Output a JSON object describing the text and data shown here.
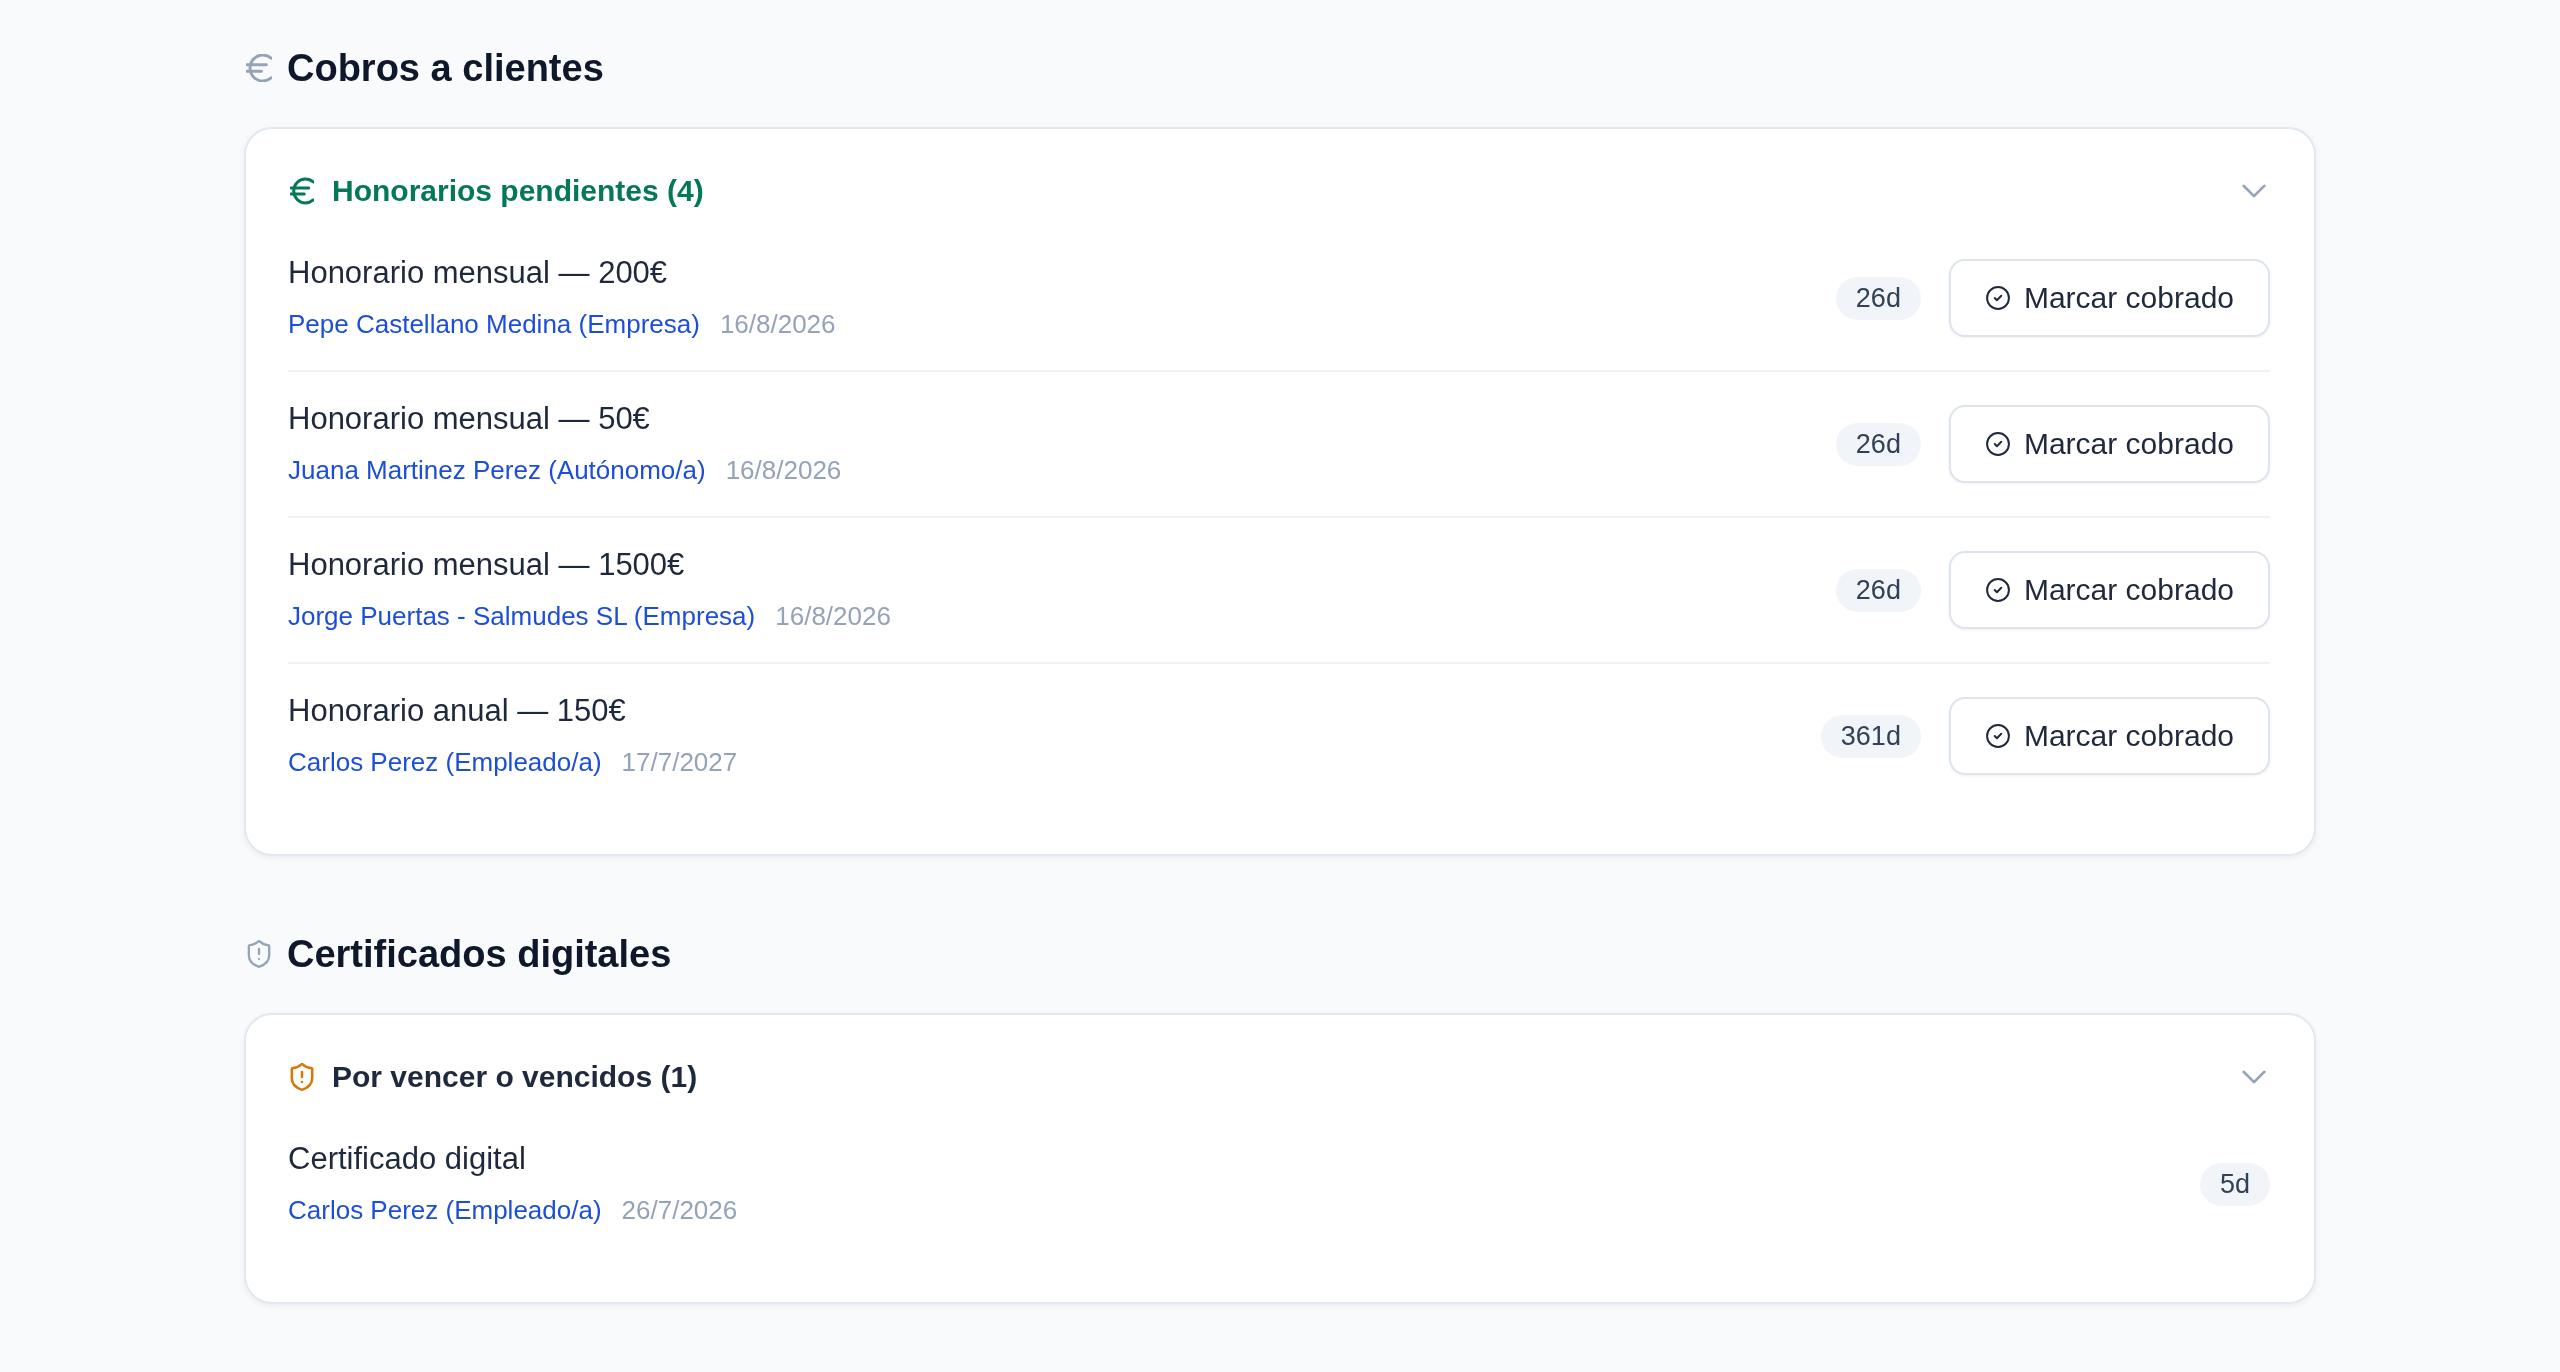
{
  "sections": [
    {
      "kind": "fees",
      "title": "Cobros a clientes",
      "group": {
        "title": "Honorarios pendientes (4)",
        "expanded": true,
        "items": [
          {
            "title": "Honorario mensual — 200€",
            "client": "Pepe Castellano Medina (Empresa)",
            "date": "16/8/2026",
            "days": "26d",
            "action": "Marcar cobrado"
          },
          {
            "title": "Honorario mensual — 50€",
            "client": "Juana Martinez Perez (Autónomo/a)",
            "date": "16/8/2026",
            "days": "26d",
            "action": "Marcar cobrado"
          },
          {
            "title": "Honorario mensual — 1500€",
            "client": "Jorge Puertas - Salmudes SL (Empresa)",
            "date": "16/8/2026",
            "days": "26d",
            "action": "Marcar cobrado"
          },
          {
            "title": "Honorario anual — 150€",
            "client": "Carlos Perez (Empleado/a)",
            "date": "17/7/2027",
            "days": "361d",
            "action": "Marcar cobrado"
          }
        ]
      }
    },
    {
      "kind": "certificates",
      "title": "Certificados digitales",
      "group": {
        "title": "Por vencer o vencidos (1)",
        "expanded": true,
        "items": [
          {
            "title": "Certificado digital",
            "client": "Carlos Perez (Empleado/a)",
            "date": "26/7/2026",
            "days": "5d"
          }
        ]
      }
    }
  ]
}
